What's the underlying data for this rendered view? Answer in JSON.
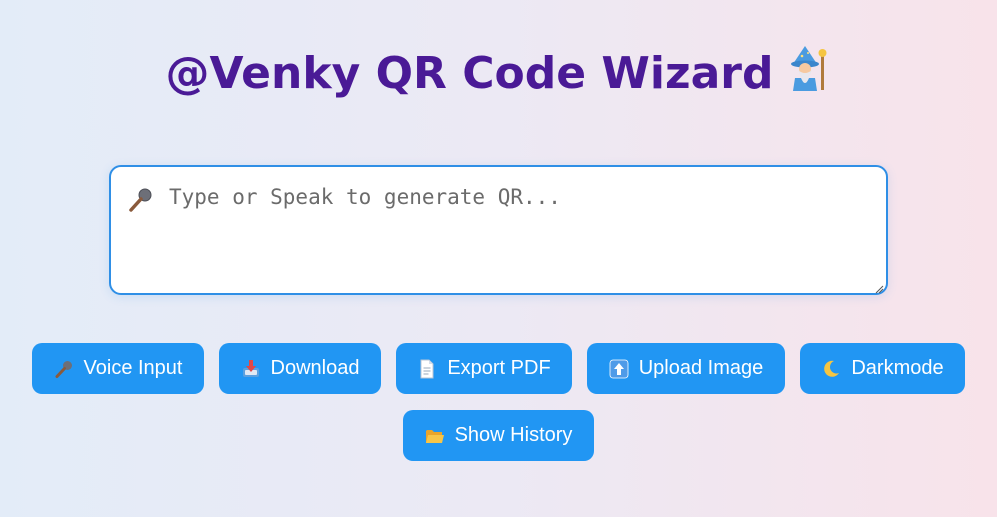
{
  "header": {
    "title": "@Venky QR Code Wizard"
  },
  "input": {
    "placeholder": "Type or Speak to generate QR...",
    "value": ""
  },
  "buttons": {
    "voice": "Voice Input",
    "download": "Download",
    "export_pdf": "Export PDF",
    "upload": "Upload Image",
    "darkmode": "Darkmode",
    "history": "Show History"
  },
  "colors": {
    "title": "#4a1a96",
    "button": "#2196f3",
    "input_border": "#2f8fe6"
  },
  "icons": {
    "title": "wizard-icon",
    "input": "microphone-icon",
    "voice": "microphone-icon",
    "download": "inbox-download-icon",
    "export_pdf": "document-icon",
    "upload": "up-arrow-icon",
    "darkmode": "crescent-moon-icon",
    "history": "folder-icon"
  }
}
